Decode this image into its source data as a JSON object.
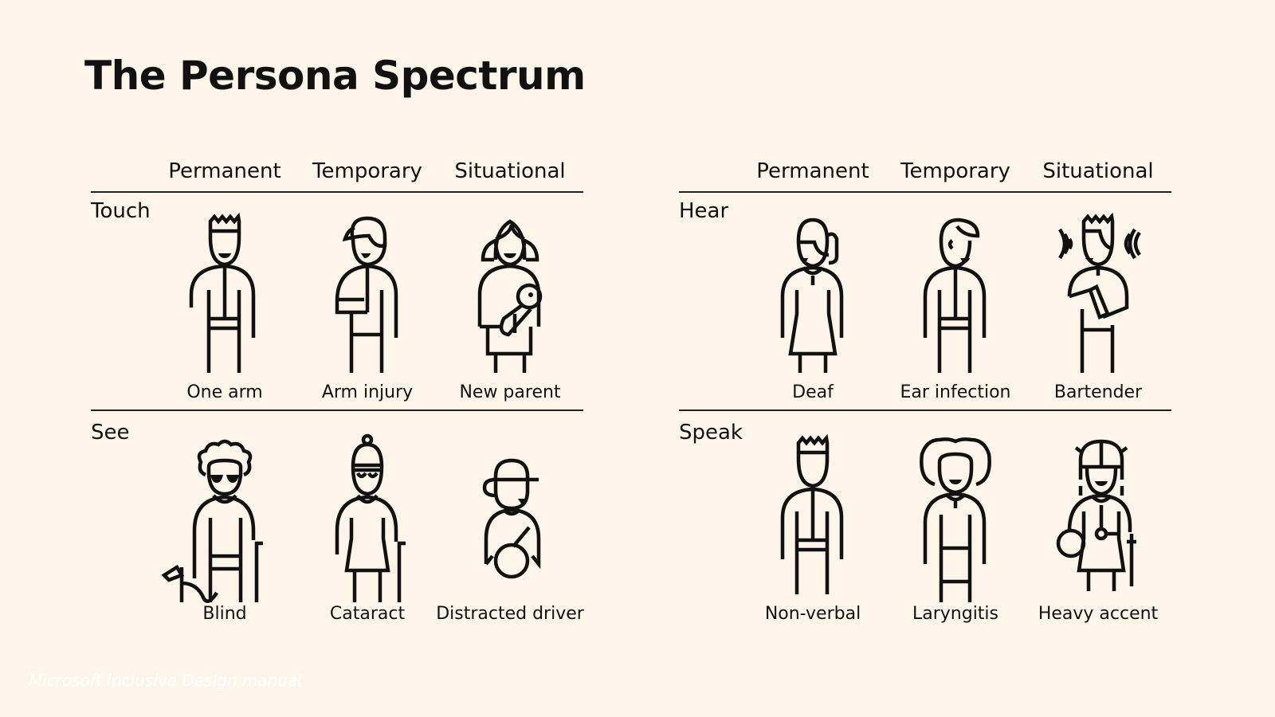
{
  "title": "The Persona Spectrum",
  "columns": [
    "Permanent",
    "Temporary",
    "Situational"
  ],
  "panels": [
    {
      "rows": [
        {
          "label": "Touch",
          "personas": [
            {
              "caption": "One arm",
              "icon": "person-one-arm-icon"
            },
            {
              "caption": "Arm injury",
              "icon": "person-arm-sling-icon"
            },
            {
              "caption": "New parent",
              "icon": "person-holding-baby-icon"
            }
          ]
        },
        {
          "label": "See",
          "personas": [
            {
              "caption": "Blind",
              "icon": "person-with-guide-dog-icon"
            },
            {
              "caption": "Cataract",
              "icon": "person-with-cane-icon"
            },
            {
              "caption": "Distracted driver",
              "icon": "person-driving-icon"
            }
          ]
        }
      ]
    },
    {
      "rows": [
        {
          "label": "Hear",
          "personas": [
            {
              "caption": "Deaf",
              "icon": "person-deaf-icon"
            },
            {
              "caption": "Ear infection",
              "icon": "person-ear-infection-icon"
            },
            {
              "caption": "Bartender",
              "icon": "person-bartender-icon"
            }
          ]
        },
        {
          "label": "Speak",
          "personas": [
            {
              "caption": "Non-verbal",
              "icon": "person-non-verbal-icon"
            },
            {
              "caption": "Laryngitis",
              "icon": "person-laryngitis-icon"
            },
            {
              "caption": "Heavy accent",
              "icon": "person-heavy-accent-icon"
            }
          ]
        }
      ]
    }
  ],
  "footer": "Microsoft Inclusive Design manual",
  "colors": {
    "background": "#fef5ea",
    "ink": "#111111",
    "watermark": "#ffffff"
  }
}
